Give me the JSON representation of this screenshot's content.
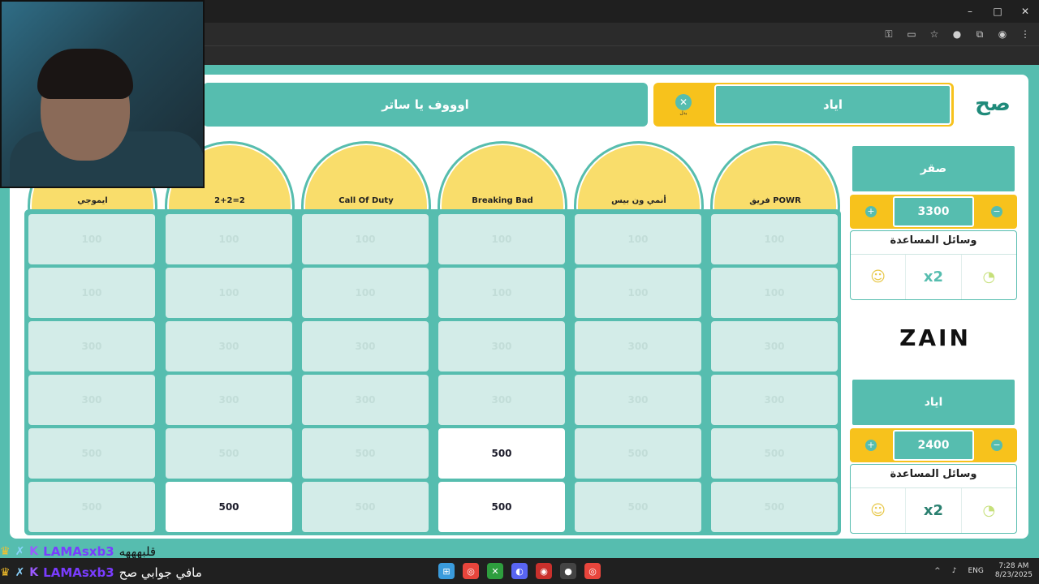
{
  "window": {
    "controls": [
      "–",
      "□",
      "✕"
    ]
  },
  "browser_icons": [
    "key-icon",
    "cast-icon",
    "star-icon",
    "extension-badge-icon",
    "extensions-icon",
    "profile-icon",
    "menu-icon"
  ],
  "question": {
    "text": "اوووف يا ساتر"
  },
  "turn": {
    "team_name": "اياد",
    "icon_label": "بدل"
  },
  "logo": {
    "text": "صح"
  },
  "categories": [
    {
      "name": "فريق POWR",
      "color": "#f9dd6b"
    },
    {
      "name": "أنمي ون بيس",
      "color": "#f9dd6b"
    },
    {
      "name": "Breaking Bad",
      "color": "#f9dd6b"
    },
    {
      "name": "Call Of Duty",
      "color": "#f9dd6b"
    },
    {
      "name": "2+2=2",
      "color": "#f9dd6b"
    },
    {
      "name": "ايموجي",
      "color": "#f9dd6b"
    }
  ],
  "board": {
    "rows": [
      [
        "100",
        "100",
        "100",
        "100",
        "100",
        "100"
      ],
      [
        "100",
        "100",
        "100",
        "100",
        "100",
        "100"
      ],
      [
        "300",
        "300",
        "300",
        "300",
        "300",
        "300"
      ],
      [
        "300",
        "300",
        "300",
        "300",
        "300",
        "300"
      ],
      [
        "500",
        "500",
        "500",
        "500",
        "500",
        "500"
      ],
      [
        "500",
        "500",
        "500",
        "500",
        "500",
        "500"
      ]
    ],
    "active": [
      [
        4,
        2
      ],
      [
        5,
        2
      ],
      [
        5,
        4
      ]
    ]
  },
  "teams": [
    {
      "name": "صقر",
      "score": "3300",
      "aids_title": "وسائل المساعدة",
      "aids": [
        "person-icon",
        "x2",
        "timer-icon"
      ]
    },
    {
      "name": "اياد",
      "score": "2400",
      "aids_title": "وسائل المساعدة",
      "aids": [
        "person-icon",
        "x2",
        "timer-icon"
      ]
    }
  ],
  "sponsor": {
    "text": "ZAIN"
  },
  "chat": [
    {
      "user": "LAMAsxb3",
      "message": "قلبهههه"
    },
    {
      "user": "LAMAsxb3",
      "message": "مافي جوابي صح"
    }
  ],
  "taskbar": {
    "apps": [
      "windows-start-icon",
      "chrome-icon",
      "xbox-icon",
      "discord-icon",
      "app-icon",
      "obs-icon",
      "chrome-alt-icon"
    ],
    "lang": "ENG",
    "time": "7:28 AM",
    "date": "8/23/2025"
  },
  "colors": {
    "teal": "#56bdaf",
    "yellow": "#f7c21c",
    "tile": "#d3ece8"
  }
}
